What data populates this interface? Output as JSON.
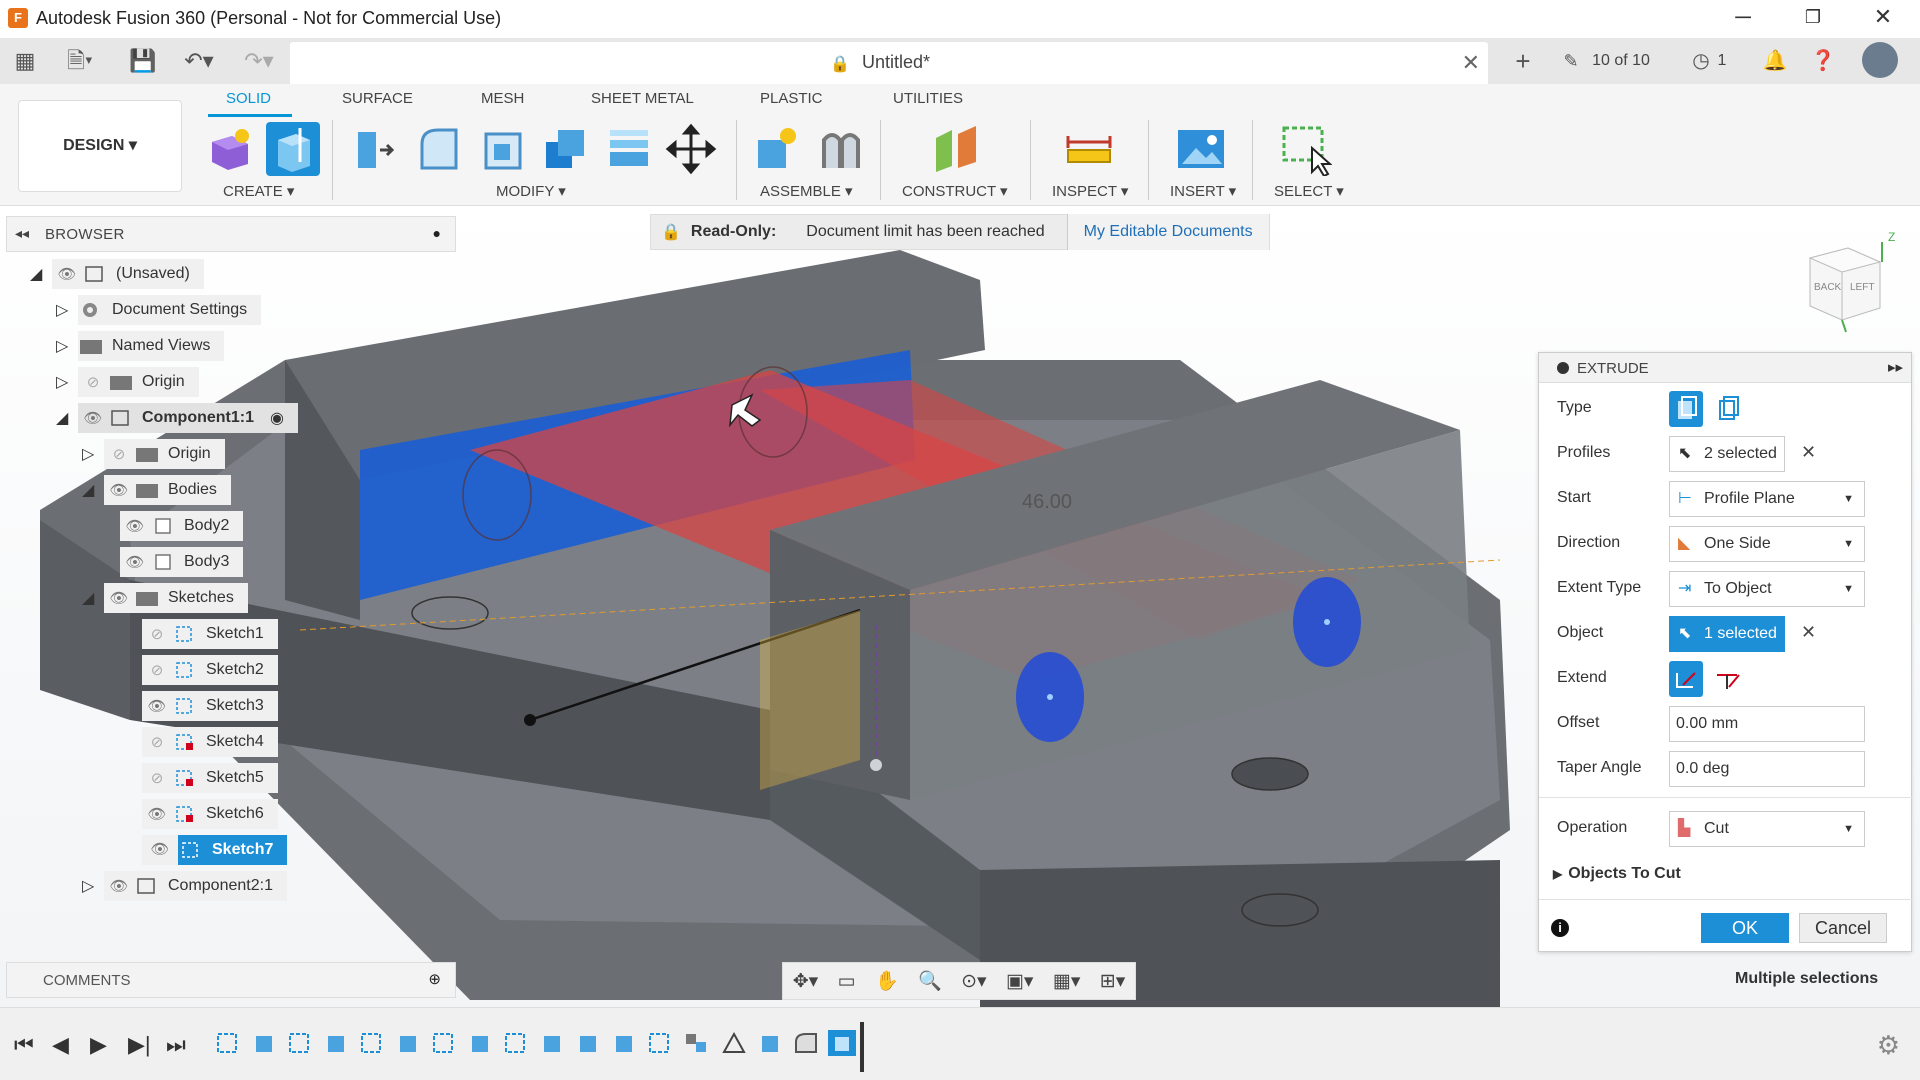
{
  "window": {
    "title": "Autodesk Fusion 360 (Personal - Not for Commercial Use)",
    "minimize": "─",
    "maximize": "❐",
    "close": "✕"
  },
  "tabbar": {
    "document_name": "Untitled*",
    "doc_count": "10 of 10",
    "jobs_count": "1"
  },
  "ribbon": {
    "workspace_button": "DESIGN ▾",
    "tabs": [
      "SOLID",
      "SURFACE",
      "MESH",
      "SHEET METAL",
      "PLASTIC",
      "UTILITIES"
    ],
    "active_tab": "SOLID",
    "groups": [
      "CREATE ▾",
      "MODIFY ▾",
      "ASSEMBLE ▾",
      "CONSTRUCT ▾",
      "INSPECT ▾",
      "INSERT ▾",
      "SELECT ▾"
    ]
  },
  "banner": {
    "readonly_label": "Read-Only:",
    "message": "Document limit has been reached",
    "link": "My Editable Documents"
  },
  "browser": {
    "title": "BROWSER",
    "items": [
      {
        "label": "(Unsaved)"
      },
      {
        "label": "Document Settings"
      },
      {
        "label": "Named Views"
      },
      {
        "label": "Origin"
      },
      {
        "label": "Component1:1"
      },
      {
        "label": "Origin"
      },
      {
        "label": "Bodies"
      },
      {
        "label": "Body2"
      },
      {
        "label": "Body3"
      },
      {
        "label": "Sketches"
      },
      {
        "label": "Sketch1"
      },
      {
        "label": "Sketch2"
      },
      {
        "label": "Sketch3"
      },
      {
        "label": "Sketch4"
      },
      {
        "label": "Sketch5"
      },
      {
        "label": "Sketch6"
      },
      {
        "label": "Sketch7"
      },
      {
        "label": "Component2:1"
      }
    ]
  },
  "comments": {
    "title": "COMMENTS"
  },
  "viewcube": {
    "face1": "BACK",
    "face2": "LEFT",
    "axis": "Z"
  },
  "viewport": {
    "dimension": "46.00"
  },
  "extrude": {
    "title": "EXTRUDE",
    "type_label": "Type",
    "profiles_label": "Profiles",
    "profiles_value": "2 selected",
    "start_label": "Start",
    "start_value": "Profile Plane",
    "direction_label": "Direction",
    "direction_value": "One Side",
    "extent_label": "Extent Type",
    "extent_value": "To Object",
    "object_label": "Object",
    "object_value": "1 selected",
    "extend_label": "Extend",
    "offset_label": "Offset",
    "offset_value": "0.00 mm",
    "taper_label": "Taper Angle",
    "taper_value": "0.0 deg",
    "operation_label": "Operation",
    "operation_value": "Cut",
    "objects_to_cut": "Objects To Cut",
    "ok": "OK",
    "cancel": "Cancel"
  },
  "status": {
    "multiple_selections": "Multiple selections"
  }
}
